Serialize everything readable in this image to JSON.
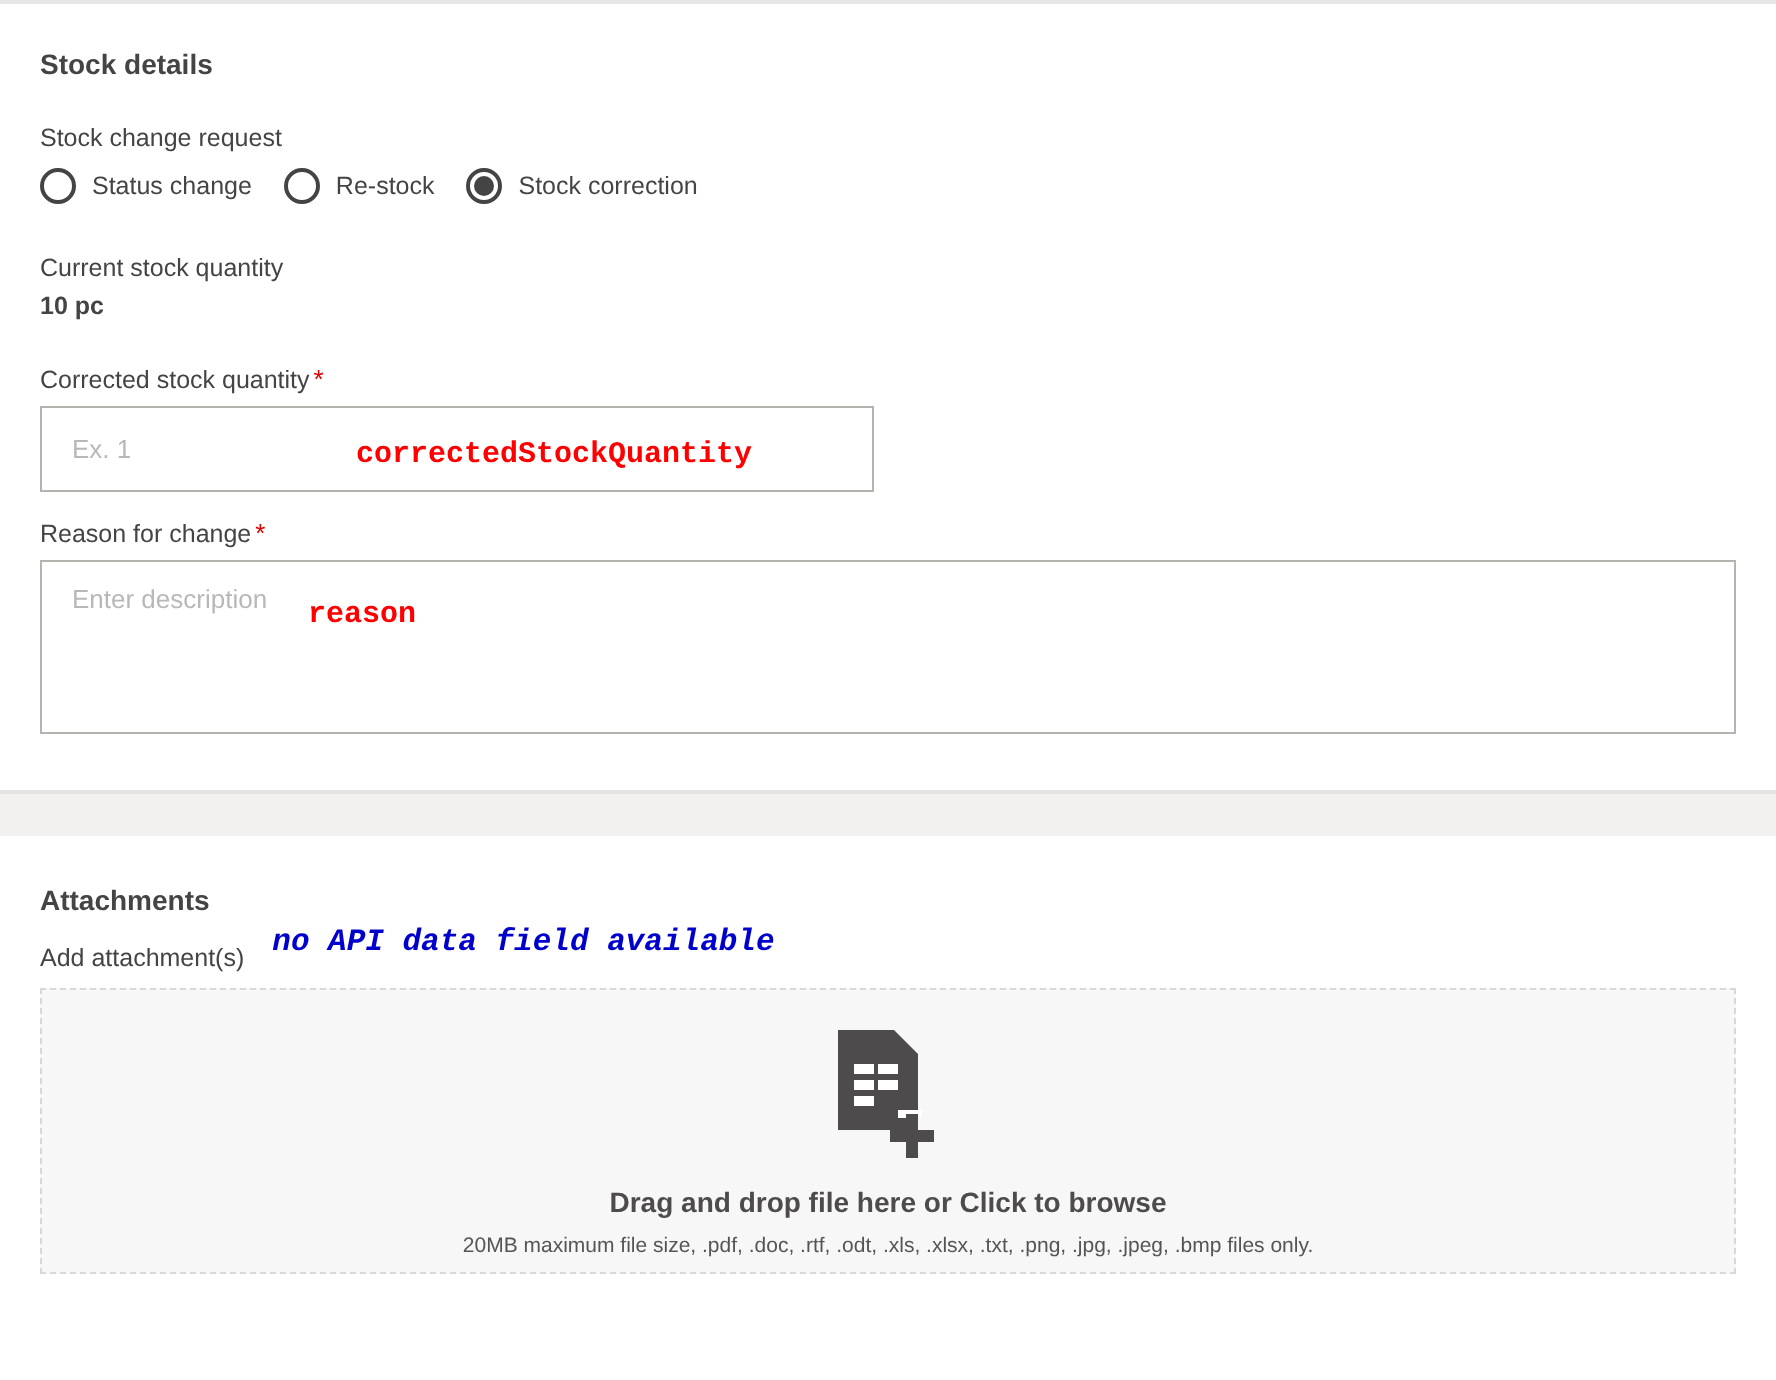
{
  "stock_details": {
    "title": "Stock details",
    "change_request": {
      "label": "Stock change request",
      "options": [
        {
          "label": "Status change",
          "selected": false
        },
        {
          "label": "Re-stock",
          "selected": false
        },
        {
          "label": "Stock correction",
          "selected": true
        }
      ]
    },
    "current_quantity": {
      "label": "Current stock quantity",
      "value": "10 pc"
    },
    "corrected_quantity": {
      "label": "Corrected stock quantity",
      "required_mark": "*",
      "placeholder": "Ex. 1",
      "annotation": {
        "text": "correctedStockQuantity",
        "color": "#ff0000"
      }
    },
    "reason": {
      "label": "Reason for change",
      "required_mark": "*",
      "placeholder": "Enter description",
      "annotation": {
        "text": "reason",
        "color": "#ff0000"
      }
    }
  },
  "attachments": {
    "title": "Attachments",
    "label": "Add attachment(s)",
    "annotation": {
      "text": "no API data field available",
      "color": "#0000cc"
    },
    "dropzone": {
      "title": "Drag and drop file here or Click to browse",
      "note": "20MB maximum file size, .pdf, .doc, .rtf, .odt, .xls, .xlsx, .txt, .png, .jpg, .jpeg, .bmp files only."
    }
  }
}
